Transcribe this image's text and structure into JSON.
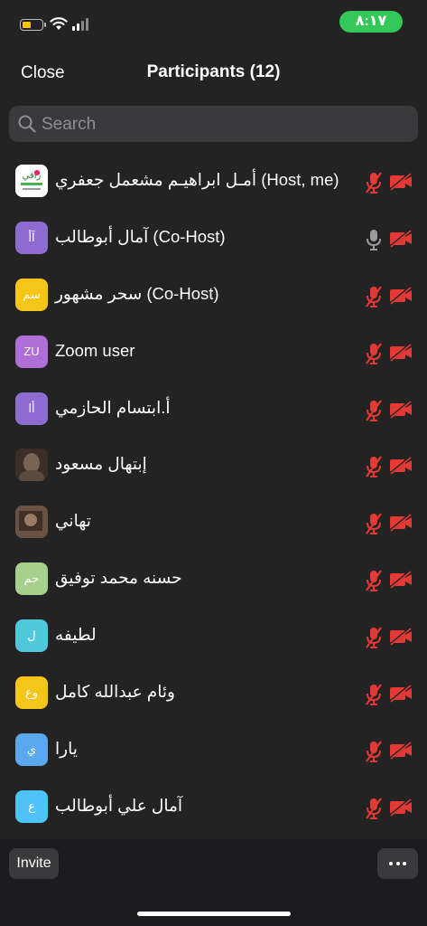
{
  "status_bar": {
    "time": "٨:١٧",
    "battery_icon": "battery-low-icon",
    "wifi_icon": "wifi-icon",
    "signal_icon": "signal-icon"
  },
  "header": {
    "close_label": "Close",
    "title": "Participants (12)"
  },
  "search": {
    "placeholder": "Search"
  },
  "participants": [
    {
      "name": "أمـل ابراهيـم مشعمل جعفري (Host, me)",
      "avatar_text": "",
      "avatar_type": "logo",
      "avatar_color": "#ffffff",
      "mic": "muted",
      "video": "off"
    },
    {
      "name": "آمال أبوطالب (Co-Host)",
      "avatar_text": "آأ",
      "avatar_type": "initials",
      "avatar_color": "#8e6bd1",
      "mic": "on",
      "video": "off"
    },
    {
      "name": "سحر مشهور (Co-Host)",
      "avatar_text": "سم",
      "avatar_type": "initials",
      "avatar_color": "#f5c518",
      "mic": "muted",
      "video": "off"
    },
    {
      "name": "Zoom user",
      "avatar_text": "ZU",
      "avatar_type": "initials",
      "avatar_color": "#b06fd6",
      "mic": "muted",
      "video": "off"
    },
    {
      "name": "أ.ابتسام الحازمي",
      "avatar_text": "أا",
      "avatar_type": "initials",
      "avatar_color": "#8e6bd1",
      "mic": "muted",
      "video": "off"
    },
    {
      "name": "إبتهال مسعود",
      "avatar_text": "",
      "avatar_type": "photo",
      "avatar_color": "#4a3a30",
      "mic": "muted",
      "video": "off"
    },
    {
      "name": "تهاني",
      "avatar_text": "",
      "avatar_type": "photo",
      "avatar_color": "#5a4235",
      "mic": "muted",
      "video": "off"
    },
    {
      "name": "حسنه محمد توفيق",
      "avatar_text": "حم",
      "avatar_type": "initials",
      "avatar_color": "#a8d08d",
      "mic": "muted",
      "video": "off"
    },
    {
      "name": "لطيفه",
      "avatar_text": "ل",
      "avatar_type": "initials",
      "avatar_color": "#4fc8dc",
      "mic": "muted",
      "video": "off"
    },
    {
      "name": "وئام عبدالله كامل",
      "avatar_text": "وع",
      "avatar_type": "initials",
      "avatar_color": "#f5c518",
      "mic": "muted",
      "video": "off"
    },
    {
      "name": "يارا",
      "avatar_text": "ي",
      "avatar_type": "initials",
      "avatar_color": "#5aa9f0",
      "mic": "muted",
      "video": "off"
    },
    {
      "name": "آمال علي أبوطالب",
      "avatar_text": "ع",
      "avatar_type": "initials",
      "avatar_color": "#4fc3f7",
      "mic": "muted",
      "video": "off"
    }
  ],
  "footer": {
    "invite_label": "Invite",
    "more_icon": "more-dots-icon"
  },
  "colors": {
    "background": "#232323",
    "muted_red": "#e53935",
    "status_green": "#34c759",
    "search_bg": "#3a3a3c"
  }
}
